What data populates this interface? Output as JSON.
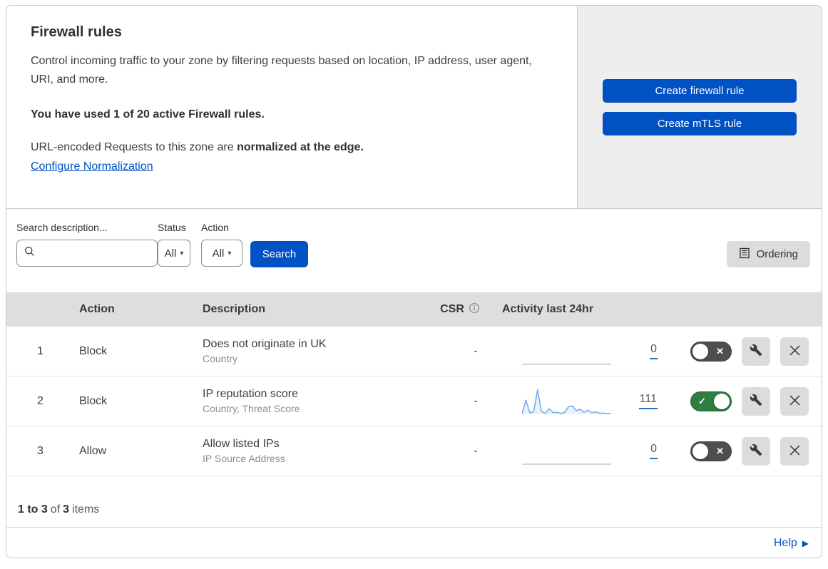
{
  "hero": {
    "title": "Firewall rules",
    "description": "Control incoming traffic to your zone by filtering requests based on location, IP address, user agent, URI, and more.",
    "usage_notice": "You have used 1 of 20 active Firewall rules.",
    "normalization_prefix": "URL-encoded Requests to this zone are ",
    "normalization_bold": "normalized at the edge.",
    "normalization_link": "Configure Normalization",
    "create_firewall_button": "Create firewall rule",
    "create_mtls_button": "Create mTLS rule"
  },
  "filters": {
    "search_label": "Search description...",
    "search_placeholder": "",
    "search_value": "",
    "status_label": "Status",
    "status_value": "All",
    "action_label": "Action",
    "action_value": "All",
    "search_button": "Search",
    "ordering_button": "Ordering"
  },
  "table": {
    "headers": {
      "action": "Action",
      "description": "Description",
      "csr": "CSR",
      "activity": "Activity last 24hr"
    },
    "rows": [
      {
        "num": "1",
        "action": "Block",
        "description": "Does not originate in UK",
        "criteria": "Country",
        "csr": "-",
        "activity_count": "0",
        "enabled": false,
        "sparkline": []
      },
      {
        "num": "2",
        "action": "Block",
        "description": "IP reputation score",
        "criteria": "Country, Threat Score",
        "csr": "-",
        "activity_count": "111",
        "enabled": true,
        "sparkline": [
          0.02,
          0.55,
          0.06,
          0.1,
          0.95,
          0.12,
          0.03,
          0.22,
          0.06,
          0.08,
          0.03,
          0.08,
          0.3,
          0.32,
          0.14,
          0.2,
          0.08,
          0.16,
          0.06,
          0.1,
          0.04,
          0.05,
          0.02,
          0.03
        ]
      },
      {
        "num": "3",
        "action": "Allow",
        "description": "Allow listed IPs",
        "criteria": "IP Source Address",
        "csr": "-",
        "activity_count": "0",
        "enabled": false,
        "sparkline": []
      }
    ]
  },
  "pagination": {
    "range": "1 to 3",
    "of": "of",
    "total": "3",
    "items": "items"
  },
  "footer": {
    "help": "Help"
  },
  "glyphs": {
    "dropdown_arrow": "▾",
    "help_arrow": "▶",
    "toggle_check": "✓",
    "toggle_x": "✕"
  },
  "icons": {
    "search": "magnifier-icon",
    "ordering": "list-page-icon",
    "csr_info": "info-circle-icon",
    "rule_edit": "wrench-icon",
    "rule_delete": "x-icon"
  },
  "colors": {
    "accent_blue": "#0051c3",
    "toggle_on_green": "#2e7d41",
    "toggle_off_gray": "#4e4e4e",
    "sparkline": "#74a9e8",
    "sparkline_fill": "rgba(116,169,232,0.16)",
    "sparkline_zero": "#b7bcc2",
    "side_panel_gray": "#eeeeee",
    "table_header_gray": "#dedede"
  }
}
